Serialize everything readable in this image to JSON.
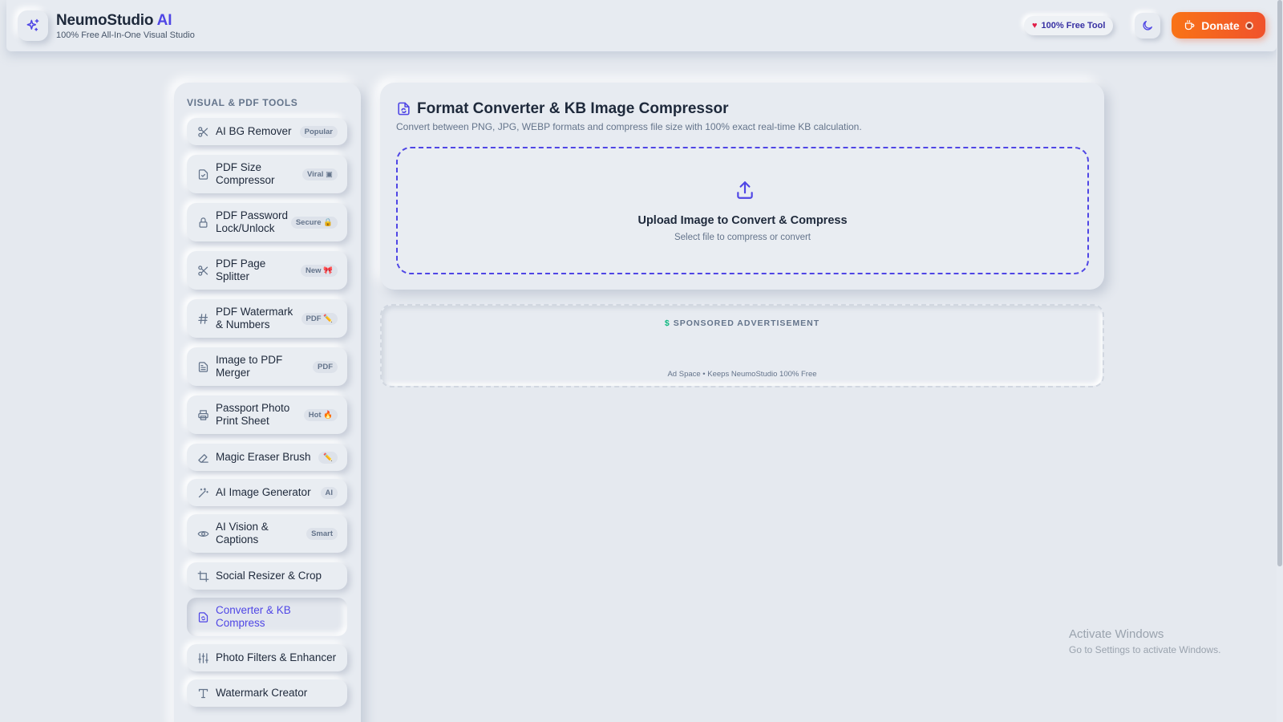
{
  "header": {
    "brand_name": "NeumoStudio",
    "brand_accent": "AI",
    "tagline": "100% Free All-In-One Visual Studio",
    "free_pill": "100% Free Tool",
    "donate_label": "Donate"
  },
  "sidebar": {
    "section_title": "VISUAL & PDF TOOLS",
    "items": [
      {
        "label": "AI BG Remover",
        "badge": "Popular",
        "icon": "scissors-icon"
      },
      {
        "label": "PDF Size Compressor",
        "badge": "Viral ▣",
        "icon": "file-compress-icon"
      },
      {
        "label": "PDF Password Lock/Unlock",
        "badge": "Secure 🔒",
        "icon": "lock-icon"
      },
      {
        "label": "PDF Page Splitter",
        "badge": "New 🎀",
        "icon": "scissors-icon"
      },
      {
        "label": "PDF Watermark & Numbers",
        "badge": "PDF ✏️",
        "icon": "hash-icon"
      },
      {
        "label": "Image to PDF Merger",
        "badge": "PDF",
        "icon": "document-icon"
      },
      {
        "label": "Passport Photo Print Sheet",
        "badge": "Hot 🔥",
        "icon": "printer-icon"
      },
      {
        "label": "Magic Eraser Brush",
        "badge": "✏️",
        "icon": "eraser-icon"
      },
      {
        "label": "AI Image Generator",
        "badge": "AI",
        "icon": "magic-wand-icon"
      },
      {
        "label": "AI Vision & Captions",
        "badge": "Smart",
        "icon": "eye-icon"
      },
      {
        "label": "Social Resizer & Crop",
        "badge": "",
        "icon": "crop-icon"
      },
      {
        "label": "Converter & KB Compress",
        "badge": "",
        "icon": "file-convert-icon"
      },
      {
        "label": "Photo Filters & Enhancer",
        "badge": "",
        "icon": "sliders-icon"
      },
      {
        "label": "Watermark Creator",
        "badge": "",
        "icon": "type-icon"
      }
    ]
  },
  "main": {
    "title": "Format Converter & KB Image Compressor",
    "description": "Convert between PNG, JPG, WEBP formats and compress file size with 100% exact real-time KB calculation.",
    "upload_title": "Upload Image to Convert & Compress",
    "upload_sub": "Select file to compress or convert"
  },
  "ad": {
    "label": "SPONSORED ADVERTISEMENT",
    "footer": "Ad Space • Keeps NeumoStudio 100% Free"
  },
  "os_watermark": {
    "title": "Activate Windows",
    "subtitle": "Go to Settings to activate Windows."
  },
  "colors": {
    "accent": "#4f46e5",
    "donate": "#f97316",
    "background": "#e5e9ef"
  }
}
